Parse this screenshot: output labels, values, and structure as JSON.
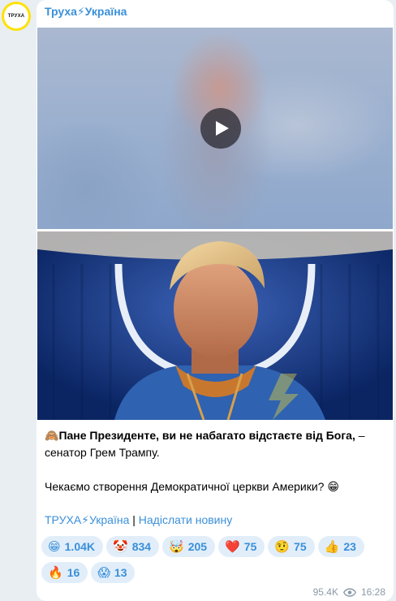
{
  "channel": {
    "name": "Труха⚡Україна",
    "avatar_text": "ТРУХА"
  },
  "post": {
    "caption_emoji": "🙈",
    "caption_bold": "Пане Президенте, ви не набагато відстаєте від Бога,",
    "caption_rest": " – сенатор Грем Трампу.",
    "caption_second": "Чекаємо створення Демократичної церкви Америки? 😁",
    "link_channel": "ТРУХА⚡Україна",
    "link_separator": " | ",
    "link_submit": "Надіслати новину",
    "views": "95.4K",
    "time": "16:28"
  },
  "reactions": [
    {
      "emoji": "😁",
      "count": "1.04K"
    },
    {
      "emoji": "🤡",
      "count": "834"
    },
    {
      "emoji": "🤯",
      "count": "205"
    },
    {
      "emoji": "❤️",
      "count": "75"
    },
    {
      "emoji": "🤨",
      "count": "75"
    },
    {
      "emoji": "👍",
      "count": "23"
    },
    {
      "emoji": "🔥",
      "count": "16"
    },
    {
      "emoji": "😱",
      "count": "13"
    }
  ],
  "colors": {
    "accent": "#3a8fd9",
    "reaction_bg": "#e1eef9",
    "chat_bg": "#e9eef2"
  },
  "icons": [
    "play-icon",
    "eye-icon"
  ]
}
